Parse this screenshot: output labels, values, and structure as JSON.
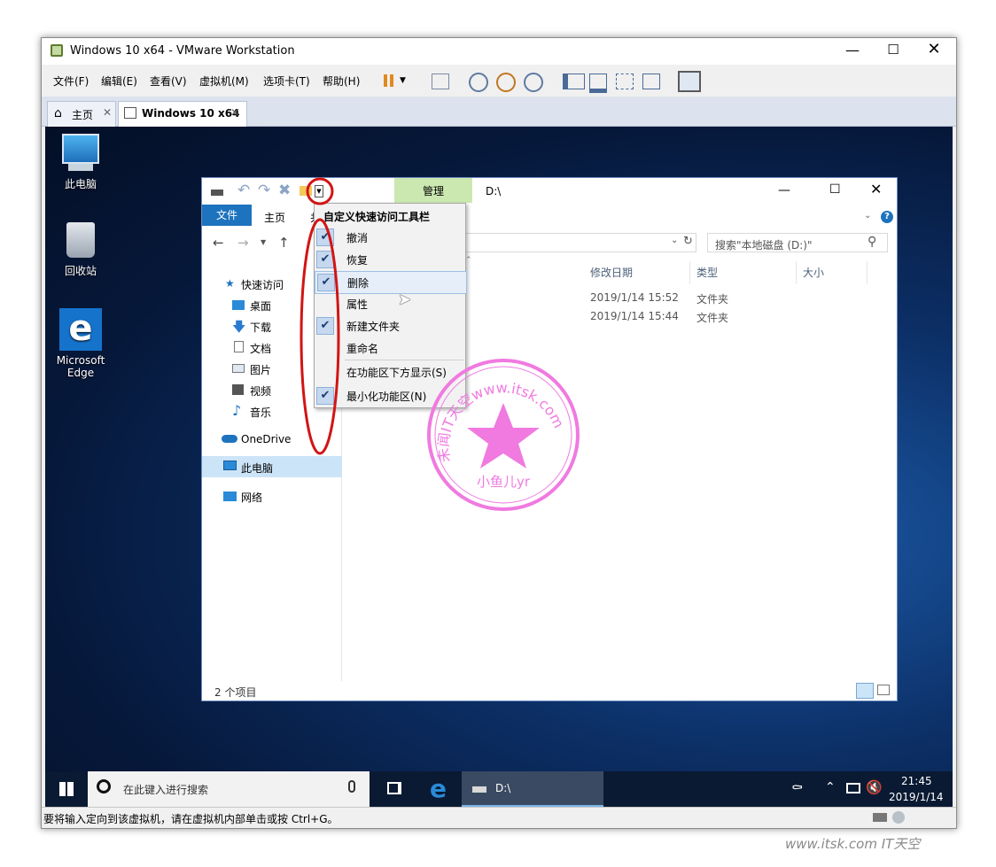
{
  "vmware": {
    "title": "Windows 10 x64 - VMware Workstation",
    "menus": [
      "文件(F)",
      "编辑(E)",
      "查看(V)",
      "虚拟机(M)",
      "选项卡(T)",
      "帮助(H)"
    ],
    "tabs": [
      {
        "label": "主页"
      },
      {
        "label": "Windows 10 x64"
      }
    ],
    "status_text": "要将输入定向到该虚拟机，请在虚拟机内部单击或按 Ctrl+G。"
  },
  "desktop": {
    "icons": [
      {
        "label": "此电脑"
      },
      {
        "label": "回收站"
      },
      {
        "label": "Microsoft Edge"
      }
    ]
  },
  "explorer": {
    "path_title": "D:\\",
    "manage_tab": "管理",
    "ribbon_tabs": [
      "文件",
      "主页",
      "共"
    ],
    "search_placeholder": "搜索\"本地磁盘 (D:)\"",
    "columns": [
      "修改日期",
      "类型",
      "大小"
    ],
    "rows": [
      {
        "date": "2019/1/14 15:52",
        "type": "文件夹"
      },
      {
        "date": "2019/1/14 15:44",
        "type": "文件夹"
      }
    ],
    "nav": [
      "快速访问",
      "桌面",
      "下载",
      "文档",
      "图片",
      "视频",
      "音乐",
      "OneDrive",
      "此电脑",
      "网络"
    ],
    "status_count": "2 个项目",
    "qat_menu": {
      "title": "自定义快速访问工具栏",
      "items": [
        {
          "label": "撤消",
          "checked": true
        },
        {
          "label": "恢复",
          "checked": true
        },
        {
          "label": "删除",
          "checked": true
        },
        {
          "label": "属性",
          "checked": false
        },
        {
          "label": "新建文件夹",
          "checked": true
        },
        {
          "label": "重命名",
          "checked": false
        },
        {
          "label": "在功能区下方显示(S)",
          "checked": false
        },
        {
          "label": "最小化功能区(N)",
          "checked": true
        }
      ]
    }
  },
  "watermark": {
    "ring_text": "未闻IT天空www.itsk.com",
    "inner_text": "小鱼儿yr",
    "color": "#f07ae0"
  },
  "taskbar": {
    "search_placeholder": "在此键入进行搜索",
    "open_window": "D:\\",
    "time": "21:45",
    "date": "2019/1/14"
  },
  "footer_watermark": "www.itsk.com IT天空",
  "colors": {
    "accent": "#1e73be",
    "annotation": "#d21414"
  }
}
